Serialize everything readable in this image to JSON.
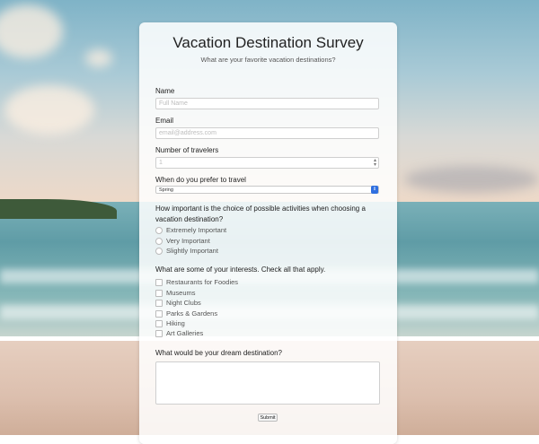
{
  "survey": {
    "title": "Vacation Destination Survey",
    "subtitle": "What are your favorite vacation destinations?"
  },
  "fields": {
    "name": {
      "label": "Name",
      "placeholder": "Full Name"
    },
    "email": {
      "label": "Email",
      "placeholder": "email@address.com"
    },
    "travelers": {
      "label": "Number of travelers",
      "placeholder": "1"
    },
    "season": {
      "label": "When do you prefer to travel",
      "selected": "Spring"
    }
  },
  "importance": {
    "question": "How important is the choice of possible activities when choosing a vacation destination?",
    "options": [
      "Extremely Important",
      "Very Important",
      "Slightly Important"
    ]
  },
  "interests": {
    "question": "What are some of your interests. Check all that apply.",
    "options": [
      "Restaurants for Foodies",
      "Museums",
      "Night Clubs",
      "Parks & Gardens",
      "Hiking",
      "Art Galleries"
    ]
  },
  "dream": {
    "question": "What would be your dream destination?"
  },
  "submit_label": "Submit",
  "colors": {
    "select_accent": "#2f6fe0"
  },
  "icons": {
    "select": "chevron-updown-icon",
    "spinner": "spinner-arrows-icon"
  }
}
